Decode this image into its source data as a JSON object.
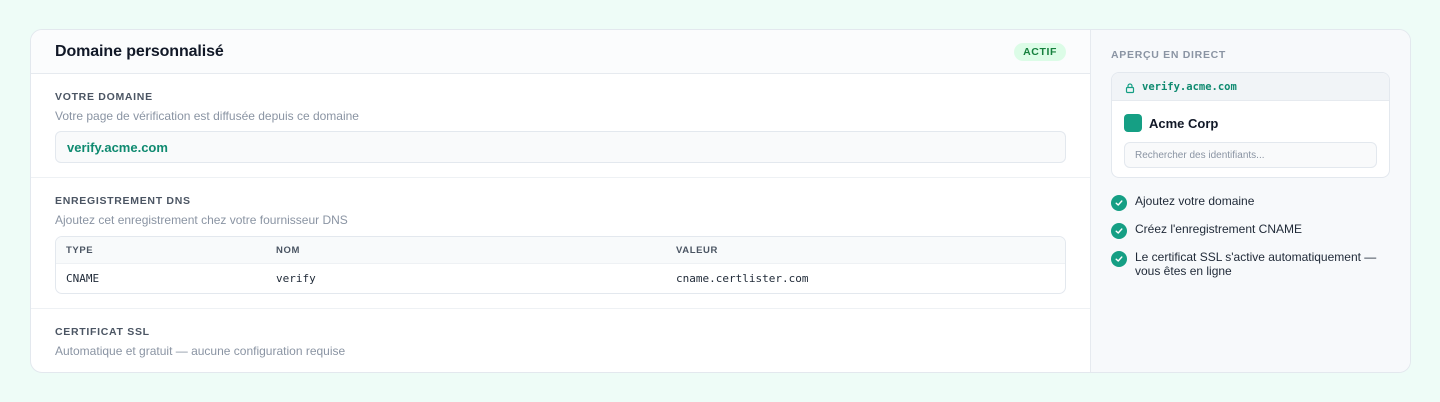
{
  "panel": {
    "title": "Domaine personnalisé",
    "status_badge": "ACTIF"
  },
  "domain_section": {
    "label": "VOTRE DOMAINE",
    "description": "Votre page de vérification est diffusée depuis ce domaine",
    "value": "verify.acme.com"
  },
  "dns_section": {
    "label": "ENREGISTREMENT DNS",
    "description": "Ajoutez cet enregistrement chez votre fournisseur DNS",
    "columns": [
      "TYPE",
      "NOM",
      "VALEUR"
    ],
    "rows": [
      {
        "type": "CNAME",
        "name": "verify",
        "value": "cname.certlister.com"
      }
    ]
  },
  "ssl_section": {
    "label": "CERTIFICAT SSL",
    "description": "Automatique et gratuit — aucune configuration requise"
  },
  "preview": {
    "title": "APERÇU EN DIRECT",
    "url": "verify.acme.com",
    "brand_name": "Acme Corp",
    "search_placeholder": "Rechercher des identifiants..."
  },
  "steps": [
    "Ajoutez votre domaine",
    "Créez l'enregistrement CNAME",
    "Le certificat SSL s'active automatiquement — vous êtes en ligne"
  ],
  "colors": {
    "accent": "#159f84",
    "accent_text": "#0f8a70",
    "badge_bg": "#dcfce7",
    "badge_text": "#15803d",
    "page_bg": "#eefcf7"
  },
  "icons": {
    "lock": "lock-icon",
    "check": "check-circle-icon"
  }
}
